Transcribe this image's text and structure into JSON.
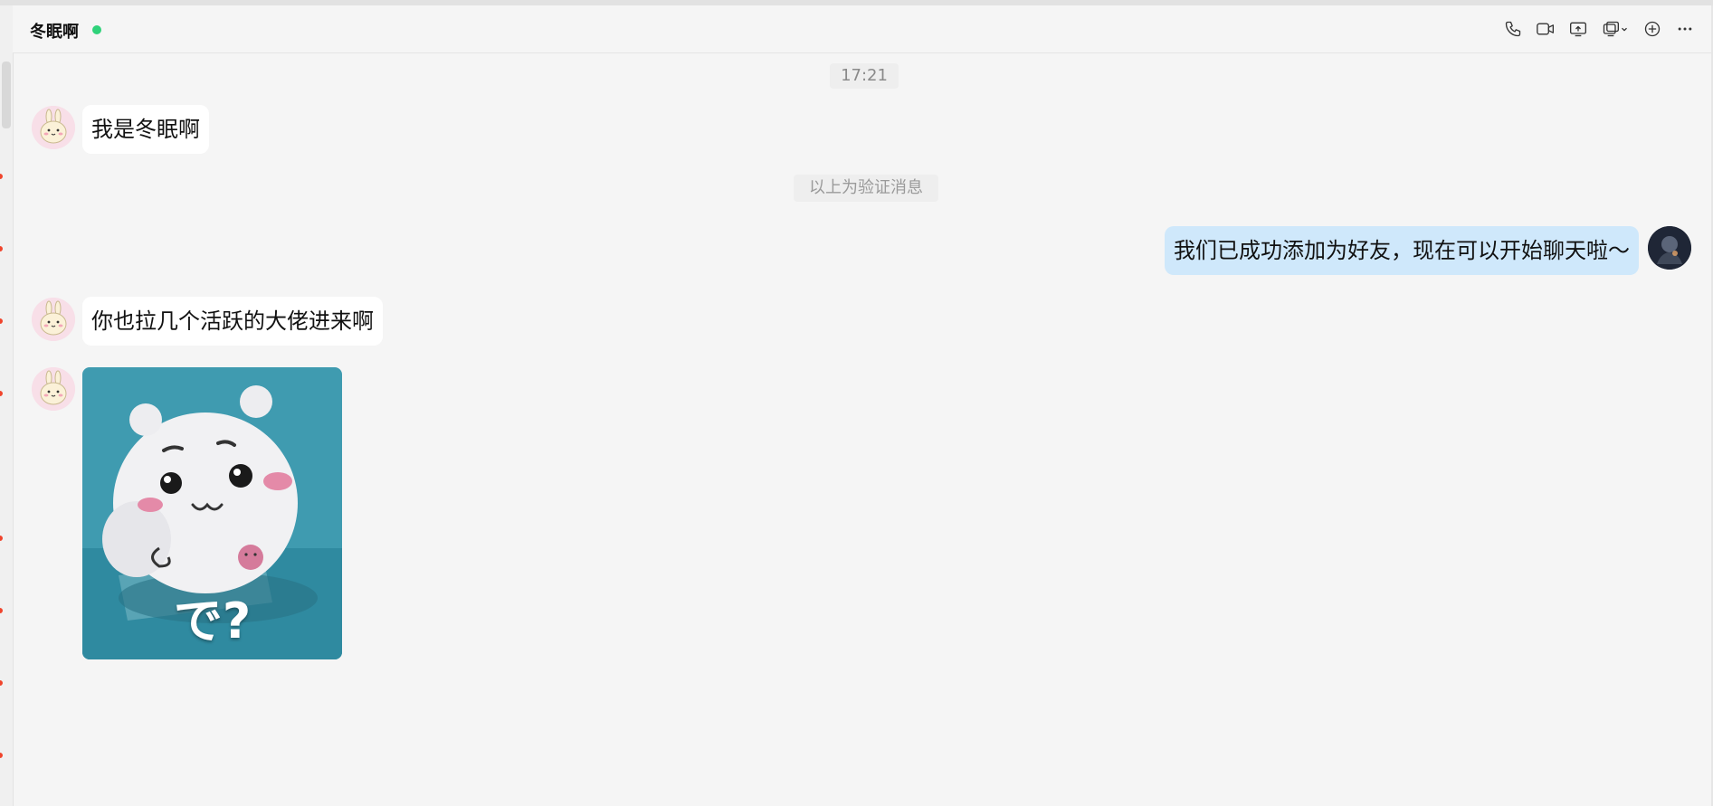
{
  "header": {
    "contact_name": "冬眠啊",
    "online_status_color": "#2fd27a",
    "toolbar_icons": [
      "phone-icon",
      "video-call-icon",
      "screen-share-icon",
      "remote-assist-icon",
      "add-icon",
      "more-icon"
    ]
  },
  "chat": {
    "timestamp": "17:21",
    "system_notice": "以上为验证消息",
    "messages": [
      {
        "sender": "contact",
        "type": "text",
        "text": "我是冬眠啊"
      },
      {
        "sender": "self",
        "type": "text",
        "text": "我们已成功添加为好友，现在可以开始聊天啦～"
      },
      {
        "sender": "contact",
        "type": "text",
        "text": "你也拉几个活跃的大佬进来啊"
      },
      {
        "sender": "contact",
        "type": "sticker",
        "caption": "で?"
      }
    ]
  },
  "colors": {
    "background": "#f5f5f5",
    "incoming_bubble": "#ffffff",
    "outgoing_bubble": "#cfe8fb",
    "unread_dot": "#f0442c"
  }
}
